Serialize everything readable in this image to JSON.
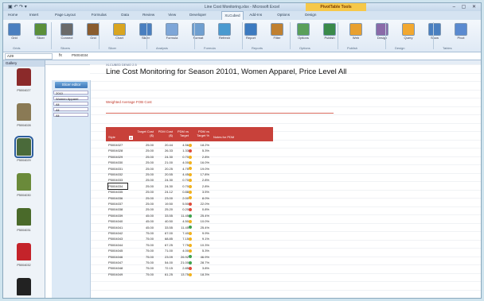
{
  "window": {
    "title": "Line Cost Monitoring.xlsx - Microsoft Excel",
    "context_tab": "PivotTable Tools",
    "controls": "– ▢ ✕",
    "qat": "▣ ↶ ↷ ▾"
  },
  "tabs": [
    "Home",
    "Insert",
    "Page Layout",
    "Formulas",
    "Data",
    "Review",
    "View",
    "Developer",
    "XLCubed",
    "Add-Ins",
    "Options",
    "Design"
  ],
  "active_tab": "XLCubed",
  "ribbon": {
    "buttons": [
      {
        "label": "Grid",
        "color": "#4a7fc0"
      },
      {
        "label": "Slicer",
        "color": "#5b8f3a"
      },
      {
        "label": "Connect",
        "color": "#6a6a6a"
      },
      {
        "label": "Grid",
        "color": "#8a5c2e"
      },
      {
        "label": "Chart",
        "color": "#d9a520"
      },
      {
        "label": "Slicer",
        "color": "#4a7fc0"
      },
      {
        "label": "Formula",
        "color": "#7ea6d8"
      },
      {
        "label": "Format",
        "color": "#6f9fd0"
      },
      {
        "label": "Refresh",
        "color": "#4a9ad0"
      },
      {
        "label": "Report",
        "color": "#3c7ac0"
      },
      {
        "label": "Filter",
        "color": "#c08030"
      },
      {
        "label": "Options",
        "color": "#5a9f5a"
      },
      {
        "label": "Publish",
        "color": "#3a8a4a"
      },
      {
        "label": "Web",
        "color": "#e8a030"
      },
      {
        "label": "Design",
        "color": "#8a6aa8"
      },
      {
        "label": "Query",
        "color": "#f2a830"
      },
      {
        "label": "Show",
        "color": "#4a7fc0"
      },
      {
        "label": "Pivot",
        "color": "#5a8ad0"
      }
    ],
    "groups": [
      "Grids",
      "Slicers",
      "Slicer",
      "Analysis",
      "Formula",
      "Reports",
      "Options",
      "Publish",
      "Design",
      "Tables"
    ]
  },
  "formula_bar": {
    "name_box": "A29",
    "fx": "fx",
    "value": "P5004034"
  },
  "gallery": {
    "header": "Gallery",
    "items": [
      {
        "label": "P5004027",
        "color": "#8b2a2a"
      },
      {
        "label": "P5004028",
        "color": "#8a7a55"
      },
      {
        "label": "P5004029",
        "color": "#4a6a3a"
      },
      {
        "label": "P5004030",
        "color": "#6a8a3a"
      },
      {
        "label": "P5004031",
        "color": "#4a6a2a"
      },
      {
        "label": "P5004032",
        "color": "#c4232a"
      },
      {
        "label": "",
        "color": "#222222"
      }
    ]
  },
  "slicer": {
    "button": "Slicer editor",
    "filters": [
      "2010",
      "Women Apparel",
      "All",
      "All",
      "All"
    ]
  },
  "report": {
    "breadcrumb": "XLCUBED DEMO 2.5",
    "title": "Line Cost Monitoring for Season 20101, Women Apparel, Price Level All",
    "subtitle": "Weighted Average FOB Cost"
  },
  "table": {
    "headers": [
      "Style",
      "Target Cost ($)",
      "PDM Cost ($)",
      "PDM vs Target",
      "PDM vs Target %",
      "Notes for PDM"
    ],
    "rows": [
      [
        "P5004027",
        "25.00",
        "20.44",
        "4.56",
        "",
        "18.2%"
      ],
      [
        "P5004028",
        "25.00",
        "26.33",
        "1.33",
        "",
        "5.3%"
      ],
      [
        "P5004029",
        "25.00",
        "24.30",
        "0.70",
        "",
        "2.8%"
      ],
      [
        "P5004030",
        "25.00",
        "21.00",
        "4.00",
        "",
        "16.0%"
      ],
      [
        "P5004031",
        "25.00",
        "20.25",
        "4.75",
        "",
        "19.0%"
      ],
      [
        "P5004032",
        "25.00",
        "20.55",
        "4.45",
        "",
        "17.8%"
      ],
      [
        "P5004033",
        "25.00",
        "24.30",
        "0.70",
        "",
        "2.8%"
      ],
      [
        "P5004034",
        "25.00",
        "24.30",
        "0.70",
        "",
        "2.8%"
      ],
      [
        "P5004035",
        "25.00",
        "24.12",
        "0.88",
        "",
        "3.5%"
      ],
      [
        "P5004036",
        "25.00",
        "23.00",
        "2.00",
        "",
        "8.0%"
      ],
      [
        "P5004037",
        "25.00",
        "19.50",
        "5.50",
        "",
        "22.0%"
      ],
      [
        "P5004038",
        "25.00",
        "25.20",
        "0.20",
        "",
        "0.8%"
      ],
      [
        "P5004039",
        "45.00",
        "33.55",
        "11.45",
        "",
        "25.4%"
      ],
      [
        "P5004040",
        "45.00",
        "40.50",
        "4.50",
        "",
        "10.0%"
      ],
      [
        "P5004041",
        "45.00",
        "33.55",
        "11.45",
        "",
        "25.4%"
      ],
      [
        "P5004042",
        "75.00",
        "67.00",
        "7.40",
        "",
        "9.9%"
      ],
      [
        "P5004043",
        "75.00",
        "68.85",
        "7.15",
        "",
        "9.1%"
      ],
      [
        "P5004044",
        "75.00",
        "67.25",
        "7.75",
        "",
        "10.3%"
      ],
      [
        "P5004045",
        "75.00",
        "71.00",
        "4.00",
        "",
        "5.3%"
      ],
      [
        "P5004046",
        "75.00",
        "23.09",
        "26.92",
        "",
        "46.9%"
      ],
      [
        "P5004047",
        "75.00",
        "54.00",
        "21.00",
        "",
        "28.7%"
      ],
      [
        "P5004048",
        "75.00",
        "72.15",
        "2.85",
        "",
        "3.8%"
      ],
      [
        "P5004049",
        "75.00",
        "61.25",
        "13.75",
        "",
        "18.3%"
      ]
    ],
    "dot_colors": [
      "#f2b21c",
      "#e04b3a",
      "#f2b21c",
      "#f2b21c",
      "#f2b21c",
      "#f2b21c",
      "#f2b21c",
      "#f2b21c",
      "#f2b21c",
      "#f2b21c",
      "#e04b3a",
      "#e04b3a",
      "#3fa34d",
      "#f2b21c",
      "#3fa34d",
      "#f2b21c",
      "#f2b21c",
      "#f2b21c",
      "#f2b21c",
      "#3fa34d",
      "#3fa34d",
      "#e04b3a",
      "#f2b21c"
    ],
    "selected_row": 7
  }
}
